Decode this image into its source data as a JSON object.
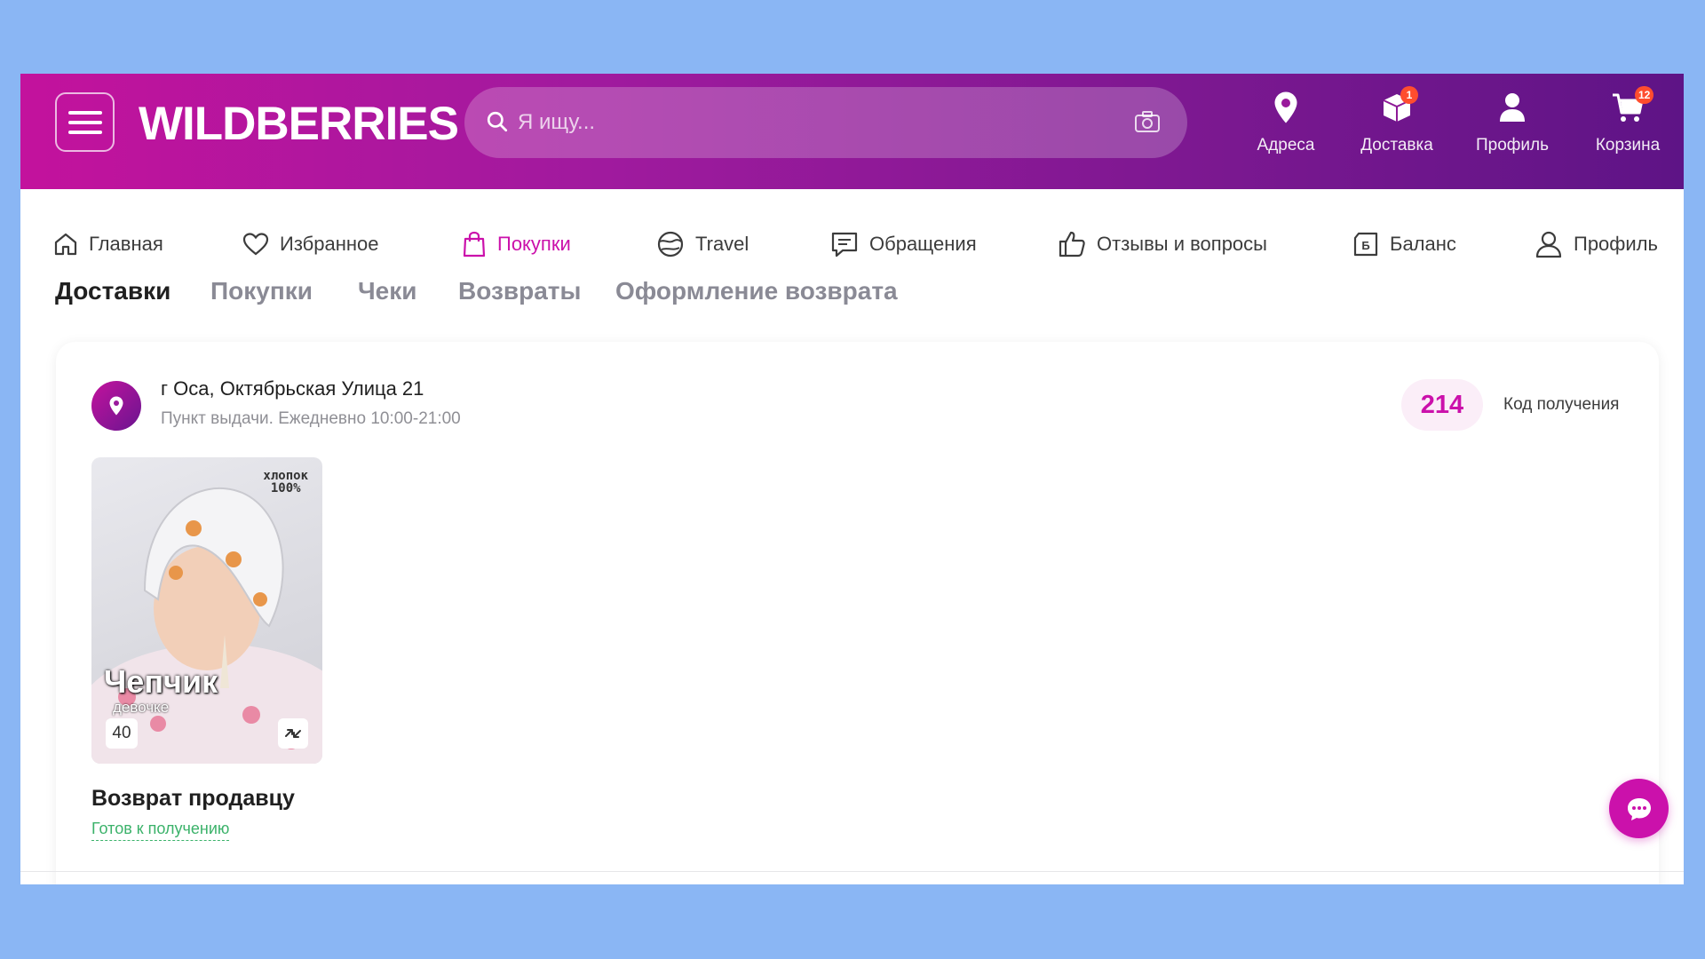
{
  "header": {
    "logo": "WILDBERRIES",
    "search_placeholder": "Я ищу...",
    "nav": [
      {
        "label": "Адреса",
        "icon": "location-pin-icon"
      },
      {
        "label": "Доставка",
        "icon": "box-icon",
        "badge": "1"
      },
      {
        "label": "Профиль",
        "icon": "user-icon"
      },
      {
        "label": "Корзина",
        "icon": "cart-icon",
        "badge": "12"
      }
    ]
  },
  "topnav": [
    {
      "label": "Главная",
      "icon": "home-icon"
    },
    {
      "label": "Избранное",
      "icon": "heart-icon"
    },
    {
      "label": "Покупки",
      "icon": "bag-icon"
    },
    {
      "label": "Travel",
      "icon": "globe-icon"
    },
    {
      "label": "Обращения",
      "icon": "message-icon"
    },
    {
      "label": "Отзывы и вопросы",
      "icon": "thumbs-up-icon"
    },
    {
      "label": "Баланс",
      "icon": "wallet-icon"
    },
    {
      "label": "Профиль",
      "icon": "user-outline-icon"
    }
  ],
  "tabs": [
    {
      "label": "Доставки",
      "active": true
    },
    {
      "label": "Покупки"
    },
    {
      "label": "Чеки"
    },
    {
      "label": "Возвраты"
    },
    {
      "label": "Оформление возврата"
    }
  ],
  "delivery": {
    "address": "г Оса, Октябрьская Улица 21",
    "hours": "Пункт выдачи. Ежедневно 10:00-21:00",
    "code": "214",
    "code_label": "Код получения",
    "product": {
      "tag_line1": "хлопок",
      "tag_line2": "100%",
      "name": "Чепчик",
      "sub": "девочке",
      "size": "40"
    },
    "status_title": "Возврат продавцу",
    "status_sub": "Готов к получению"
  },
  "colors": {
    "accent": "#cb11ab",
    "success": "#3bb26a",
    "background": "#8ab6f4"
  }
}
